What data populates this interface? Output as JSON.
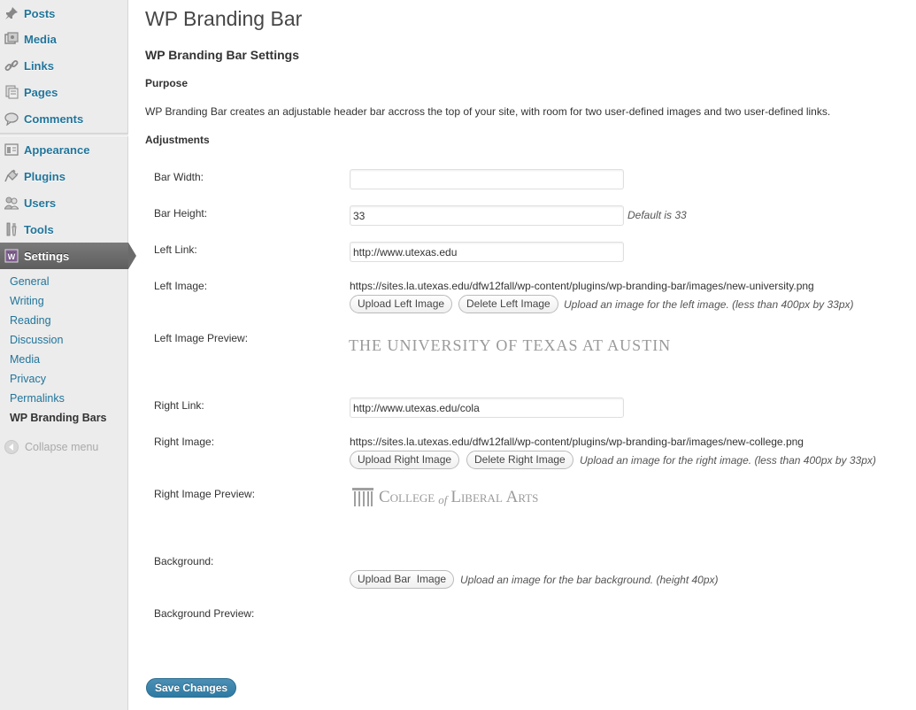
{
  "sidebar": {
    "items": [
      {
        "label": "Posts",
        "icon": "pushpin-icon"
      },
      {
        "label": "Media",
        "icon": "media-icon"
      },
      {
        "label": "Links",
        "icon": "link-icon"
      },
      {
        "label": "Pages",
        "icon": "pages-icon"
      },
      {
        "label": "Comments",
        "icon": "comment-icon"
      },
      {
        "label": "Appearance",
        "icon": "appearance-icon"
      },
      {
        "label": "Plugins",
        "icon": "plugin-icon"
      },
      {
        "label": "Users",
        "icon": "users-icon"
      },
      {
        "label": "Tools",
        "icon": "tools-icon"
      },
      {
        "label": "Settings",
        "icon": "settings-icon"
      }
    ],
    "submenu": [
      "General",
      "Writing",
      "Reading",
      "Discussion",
      "Media",
      "Privacy",
      "Permalinks",
      "WP Branding Bars"
    ],
    "collapse_label": "Collapse menu"
  },
  "page": {
    "title": "WP Branding Bar",
    "settings_heading": "WP Branding Bar Settings",
    "purpose_heading": "Purpose",
    "purpose_text": "WP Branding Bar creates an adjustable header bar accross the top of your site, with room for two user-defined images and two user-defined links.",
    "adjustments_heading": "Adjustments"
  },
  "form": {
    "bar_width": {
      "label": "Bar Width:",
      "value": ""
    },
    "bar_height": {
      "label": "Bar Height:",
      "value": "33",
      "hint": "Default is 33"
    },
    "left_link": {
      "label": "Left Link:",
      "value": "http://www.utexas.edu"
    },
    "left_image": {
      "label": "Left Image:",
      "url": "https://sites.la.utexas.edu/dfw12fall/wp-content/plugins/wp-branding-bar/images/new-university.png",
      "upload_label": "Upload Left Image",
      "delete_label": "Delete Left Image",
      "hint": "Upload an image for the left image. (less than 400px by 33px)"
    },
    "left_preview": {
      "label": "Left Image Preview:",
      "text": "THE UNIVERSITY OF TEXAS AT AUSTIN"
    },
    "right_link": {
      "label": "Right Link:",
      "value": "http://www.utexas.edu/cola"
    },
    "right_image": {
      "label": "Right Image:",
      "url": "https://sites.la.utexas.edu/dfw12fall/wp-content/plugins/wp-branding-bar/images/new-college.png",
      "upload_label": "Upload Right Image",
      "delete_label": "Delete Right Image",
      "hint": "Upload an image for the right image. (less than 400px by 33px)"
    },
    "right_preview": {
      "label": "Right Image Preview:",
      "text_a": "College",
      "text_of": "of",
      "text_b": "Liberal Arts"
    },
    "background": {
      "label": "Background:",
      "upload_label": "Upload Bar  Image",
      "hint": "Upload an image for the bar background. (height 40px)"
    },
    "background_preview": {
      "label": "Background Preview:"
    },
    "save_label": "Save Changes"
  },
  "colors": {
    "link": "#21759b",
    "accent": "#2e7aa3",
    "current_menu": "#6b6b6b"
  }
}
